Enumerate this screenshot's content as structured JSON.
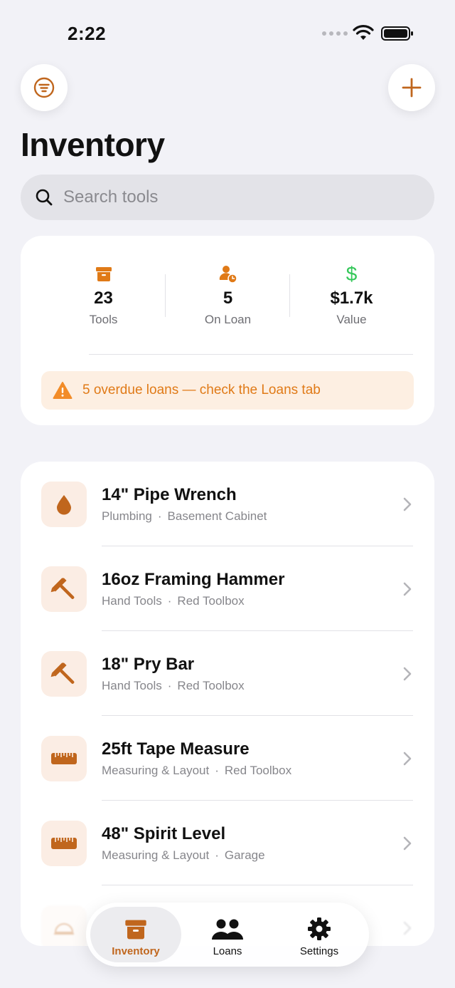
{
  "status_bar": {
    "time": "2:22"
  },
  "header": {
    "title": "Inventory"
  },
  "search": {
    "placeholder": "Search tools"
  },
  "stats": {
    "tools": {
      "value": "23",
      "label": "Tools"
    },
    "on_loan": {
      "value": "5",
      "label": "On Loan"
    },
    "value": {
      "value": "$1.7k",
      "label": "Value"
    },
    "alert": "5 overdue loans — check the Loans tab"
  },
  "tools": [
    {
      "name": "14\" Pipe Wrench",
      "category": "Plumbing",
      "location": "Basement Cabinet",
      "icon": "drop-icon"
    },
    {
      "name": "16oz Framing Hammer",
      "category": "Hand Tools",
      "location": "Red Toolbox",
      "icon": "hammer-icon"
    },
    {
      "name": "18\" Pry Bar",
      "category": "Hand Tools",
      "location": "Red Toolbox",
      "icon": "hammer-icon"
    },
    {
      "name": "25ft Tape Measure",
      "category": "Measuring & Layout",
      "location": "Red Toolbox",
      "icon": "ruler-icon"
    },
    {
      "name": "48\" Spirit Level",
      "category": "Measuring & Layout",
      "location": "Garage",
      "icon": "ruler-icon"
    }
  ],
  "tab_bar": {
    "inventory": "Inventory",
    "loans": "Loans",
    "settings": "Settings"
  },
  "colors": {
    "accent": "#c0661d",
    "alert_text": "#e07a17",
    "value_green": "#34c759",
    "icon_bg": "#fbede4"
  }
}
